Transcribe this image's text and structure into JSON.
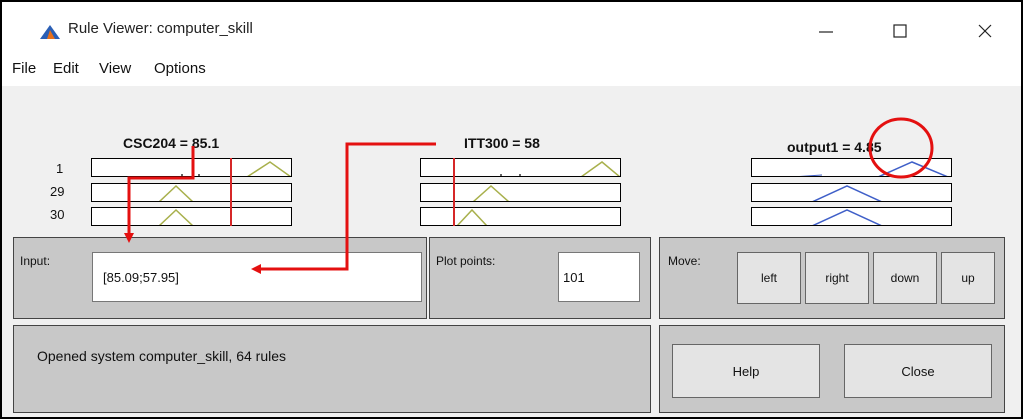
{
  "window": {
    "title": "Rule Viewer: computer_skill",
    "controls": {
      "minimize": "—",
      "maximize": "☐",
      "close": "✕"
    }
  },
  "menu": [
    "File",
    "Edit",
    "View",
    "Options"
  ],
  "variables": [
    {
      "title": "CSC204 = 85.1"
    },
    {
      "title": "ITT300 = 58"
    },
    {
      "title": "output1 = 4.85"
    }
  ],
  "rule_numbers": [
    "1",
    "29",
    "30"
  ],
  "input": {
    "label": "Input:",
    "value": "[85.09;57.95]"
  },
  "plot_points": {
    "label": "Plot points:",
    "value": "101"
  },
  "move": {
    "label": "Move:",
    "buttons": [
      "left",
      "right",
      "down",
      "up"
    ]
  },
  "status": "Opened system computer_skill, 64 rules",
  "actions": {
    "help": "Help",
    "close": "Close"
  },
  "colors": {
    "window_bg": "#f0f0f0",
    "panel_bg": "#c8c8c8",
    "cursor_red": "#d62728",
    "membership_olive": "#a8b04c",
    "membership_blue": "#3f5fc8",
    "annotation_red": "#e41010"
  }
}
